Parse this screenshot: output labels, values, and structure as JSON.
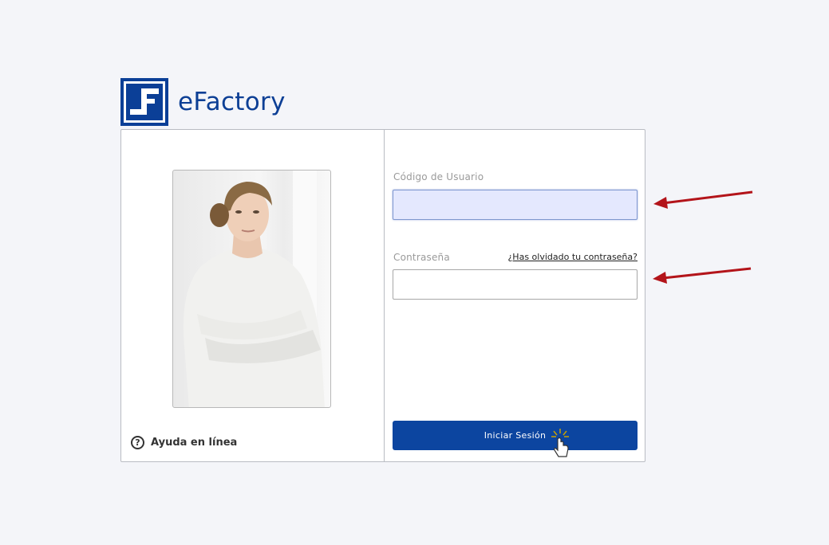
{
  "brand": {
    "name": "eFactory",
    "logo_icon": "efactory-logo-icon",
    "color": "#0d3f95"
  },
  "left_panel": {
    "photo": "woman-portrait-image",
    "help": {
      "icon": "help-circle-icon",
      "icon_glyph": "?",
      "label": "Ayuda en línea"
    }
  },
  "login_form": {
    "username": {
      "label": "Código de Usuario",
      "value": "",
      "placeholder": ""
    },
    "password": {
      "label": "Contraseña",
      "value": "",
      "placeholder": ""
    },
    "forgot_link": "¿Has olvidado tu contraseña?",
    "submit_label": "Iniciar Sesión"
  },
  "colors": {
    "accent": "#0c45a0",
    "input_focus_bg": "#e4e8fe",
    "annotation_arrow": "#b3141a",
    "background": "#f4f5f9"
  },
  "annotations": {
    "arrow_icon": "red-arrow-icon",
    "cursor_icon": "hand-pointer-icon"
  }
}
